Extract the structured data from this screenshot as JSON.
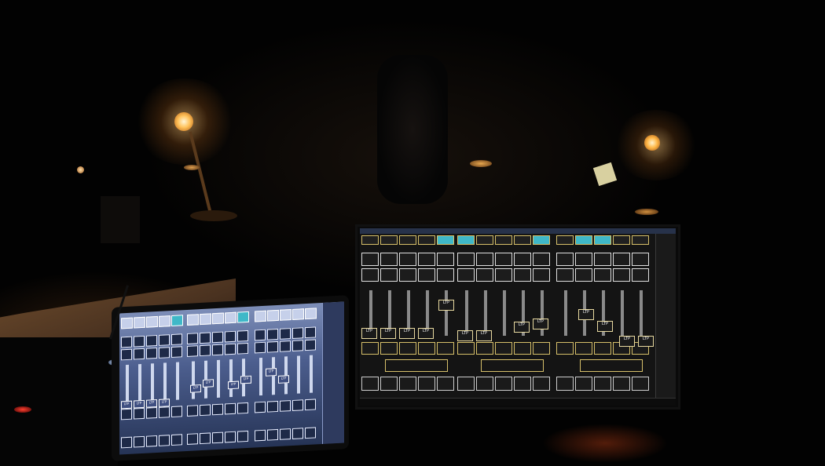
{
  "scene": {
    "description_free": true
  },
  "big_screen": {
    "ltp_label": "LTP",
    "rows": 4,
    "groups": 3
  },
  "tablet_screen": {
    "ltp_label": "LTP"
  },
  "colors": {
    "accent_teal": "#3fb8c8",
    "frame_yellow": "#d7c06a",
    "lamp_orange": "#ffb04a"
  }
}
